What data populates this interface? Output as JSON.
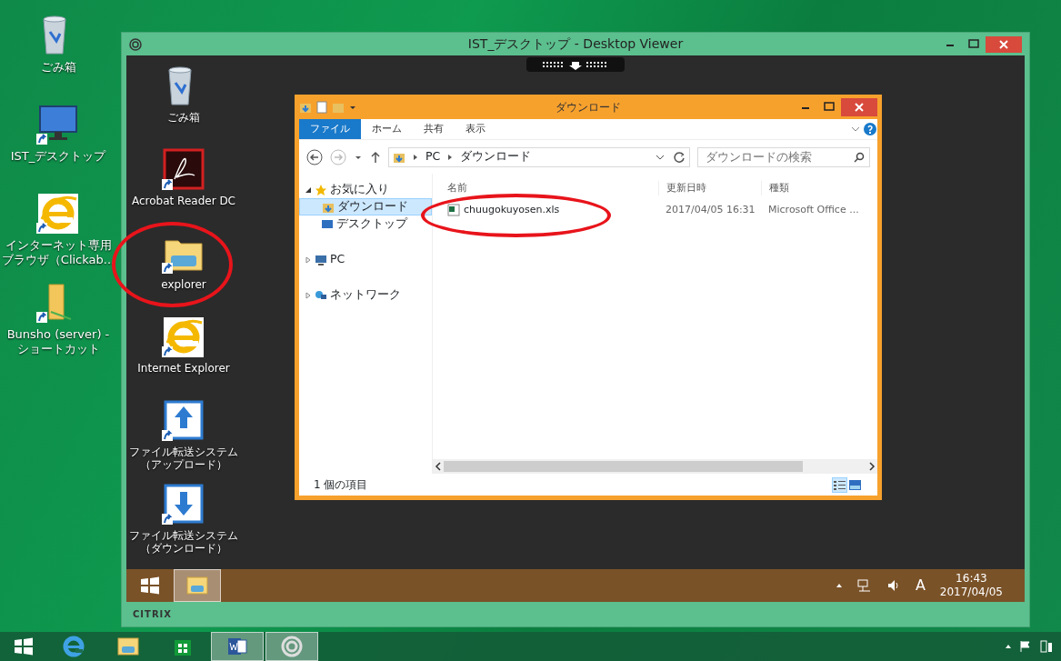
{
  "desktop_icons": [
    {
      "kind": "trash",
      "label": "ごみ箱"
    },
    {
      "kind": "monitor",
      "label": "IST_デスクトップ"
    },
    {
      "kind": "ie",
      "label": "インターネット専用ブラウザ（Clickab..."
    },
    {
      "kind": "folder",
      "label": "Bunsho (server) - ショートカット"
    }
  ],
  "viewer": {
    "title": "IST_デスクトップ - Desktop Viewer",
    "remote_icons": [
      {
        "kind": "trash",
        "label": "ごみ箱"
      },
      {
        "kind": "pdf",
        "label": "Acrobat Reader DC"
      },
      {
        "kind": "explorer",
        "label": "explorer"
      },
      {
        "kind": "ie",
        "label": "Internet Explorer"
      },
      {
        "kind": "upload",
        "label": "ファイル転送システム（アップロード）"
      },
      {
        "kind": "download",
        "label": "ファイル転送システム（ダウンロード）"
      }
    ],
    "explorer": {
      "title": "ダウンロード",
      "ribbon_tabs": [
        {
          "label": "ファイル",
          "selected": true
        },
        {
          "label": "ホーム",
          "selected": false
        },
        {
          "label": "共有",
          "selected": false
        },
        {
          "label": "表示",
          "selected": false
        }
      ],
      "path": [
        "PC",
        "ダウンロード"
      ],
      "search": {
        "placeholder": "ダウンロードの検索"
      },
      "nav": [
        {
          "kind": "star",
          "label": "お気に入り",
          "expanded": true,
          "selected": false,
          "children": [
            {
              "kind": "download",
              "label": "ダウンロード",
              "selected": true
            },
            {
              "kind": "desktop",
              "label": "デスクトップ",
              "selected": false
            }
          ]
        },
        {
          "kind": "pc",
          "label": "PC",
          "expanded": false,
          "selected": false
        },
        {
          "kind": "network",
          "label": "ネットワーク",
          "expanded": false,
          "selected": false
        }
      ],
      "columns": [
        "名前",
        "更新日時",
        "種類"
      ],
      "files": [
        {
          "name": "chuugokuyosen.xls",
          "modified": "2017/04/05 16:31",
          "type": "Microsoft Office ..."
        }
      ],
      "status": "1 個の項目",
      "view_modes": [
        {
          "kind": "details",
          "selected": true
        },
        {
          "kind": "thumbs",
          "selected": false
        }
      ]
    },
    "taskbar": {
      "apps": [
        {
          "kind": "explorer",
          "selected": true
        }
      ],
      "ime": "A",
      "time": "16:43",
      "date": "2017/04/05"
    },
    "brand": "CITRIX"
  },
  "taskbar": {
    "apps": [
      {
        "kind": "ie",
        "selected": false
      },
      {
        "kind": "explorer",
        "selected": false
      },
      {
        "kind": "store",
        "selected": false
      },
      {
        "kind": "word",
        "selected": true
      },
      {
        "kind": "receiver",
        "selected": true
      }
    ]
  }
}
